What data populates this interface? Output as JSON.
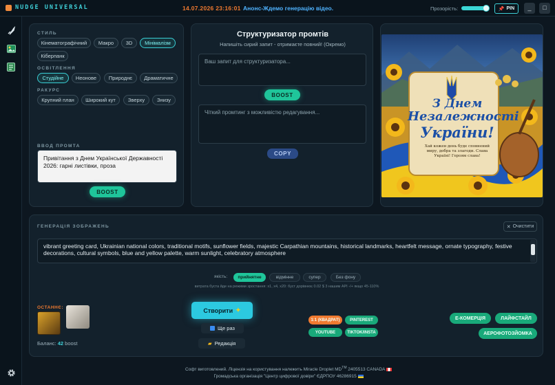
{
  "header": {
    "app_title": "NUDGE UNIVERSAL",
    "datetime": "14.07.2026 23:16:01",
    "announcement": "Анонс-Ждемо генерацію відео.",
    "transparency_label": "Прозорість:",
    "pin_label": "PIN",
    "minimize_label": "_",
    "close_label": "□"
  },
  "settings": {
    "style_title": "СТИЛЬ",
    "style_chips": [
      "Кінематографічний",
      "Макро",
      "3D",
      "Мінімалізм",
      "Кіберпанк"
    ],
    "lighting_title": "ОСВІТЛЕННЯ",
    "lighting_chips": [
      "Студійне",
      "Неонове",
      "Природнє",
      "Драматичне"
    ],
    "angle_title": "РАКУРС",
    "angle_chips": [
      "Крупний план",
      "Широкий кут",
      "Зверху",
      "Знизу"
    ],
    "prompt_title": "ВВОД ПРОМТА",
    "prompt_text": "Привітання з Днем Української Державності 2026: гарні листівки, проза",
    "boost_label": "BOOST"
  },
  "structurizer": {
    "title": "Структуризатор промтів",
    "subtitle": "Напишіть сирий запит - отримаєте повний! (Окремо)",
    "input_placeholder": "Ваш запит для структуризатора...",
    "boost_label": "BOOST",
    "output_placeholder": "Чіткий промтинг з можливістю редагування...",
    "copy_label": "COPY"
  },
  "preview": {
    "line1": "З Днем",
    "line2": "Незалежності",
    "line3": "України!",
    "body": "Хай кожен день буде сповнений миру, добра та злагоди. Слава Україні! Героям слава!"
  },
  "generation": {
    "title": "ГЕНЕРАЦІЯ ЗОБРАЖЕНЬ",
    "clear_label": "Очистити",
    "prompt": "vibrant greeting card, Ukrainian national colors, traditional motifs, sunflower fields, majestic Carpathian mountains, historical landmarks, heartfelt message, ornate typography, festive decorations, cultural symbols, blue and yellow palette, warm sunlight, celebratory atmosphere",
    "quality_label": "якість:",
    "quality_options": [
      "прийнятне",
      "відмінне",
      "супер",
      "Без фону"
    ],
    "cost_note": "витрата буста йде на режими зростання: х1, х4, х20: буст дорівнює 0.02 $ 3 нашим API -/+ якщо 45-110%",
    "recent_label": "ОСТАННЄ:",
    "balance_label": "Баланс:",
    "balance_value": "42",
    "balance_unit": "boost",
    "create_label": "Створити",
    "once_label": "Ще раз",
    "edit_label": "Редакція",
    "format_tags": [
      "1:1 (КВАДРАТ)",
      "PINTEREST",
      "YOUTUBE",
      "TIKTOK/INSTA"
    ],
    "market_tags": [
      "E-КОМЕРЦІЯ",
      "ЛАЙФСТАЙЛ",
      "АЕРОФОТОЗЙОМКА"
    ]
  },
  "footer": {
    "line1_pre": "Софт виготовлений. Ліцензія на користування належить Miracle Droplet MD",
    "line1_tm": "TM",
    "line1_post": " 2405513 CANADA",
    "line2": "Громадська організація \"Центр цифрової довіри\" ЄДРПОУ 46286915"
  },
  "colors": {
    "accent_cyan": "#3fd0d8",
    "accent_green": "#1fc59a",
    "accent_orange": "#f07a30",
    "background": "#0d1720"
  }
}
